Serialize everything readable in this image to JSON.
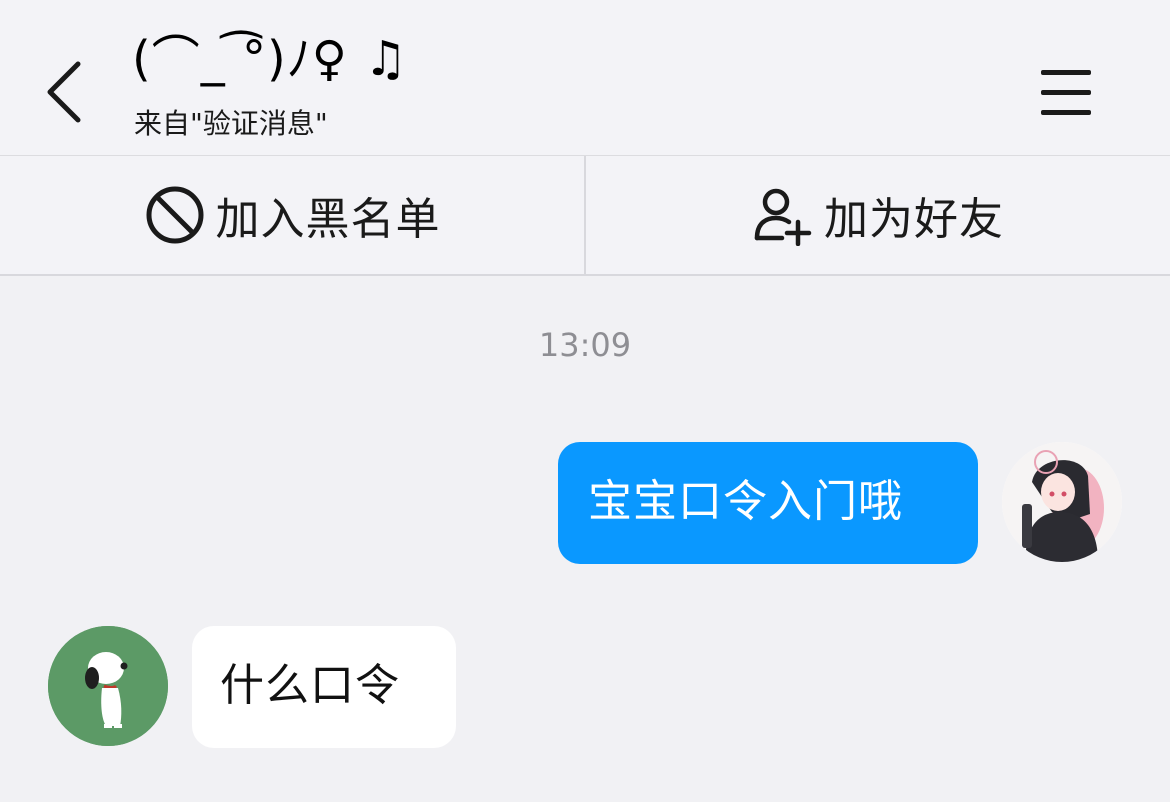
{
  "header": {
    "title": "(⌒_ ͡°)ﾉ♀ ♫",
    "subtitle": "来自\"验证消息\""
  },
  "actions": {
    "blacklist_label": "加入黑名单",
    "add_friend_label": "加为好友"
  },
  "chat": {
    "timestamp": "13:09",
    "messages": [
      {
        "sender": "me",
        "text": "宝宝口令入门哦"
      },
      {
        "sender": "peer",
        "text": "什么口令"
      }
    ]
  },
  "colors": {
    "outgoing_bubble": "#0a98ff",
    "incoming_bubble": "#ffffff",
    "background": "#f1f1f4",
    "peer_avatar_bg": "#5c9a66"
  }
}
